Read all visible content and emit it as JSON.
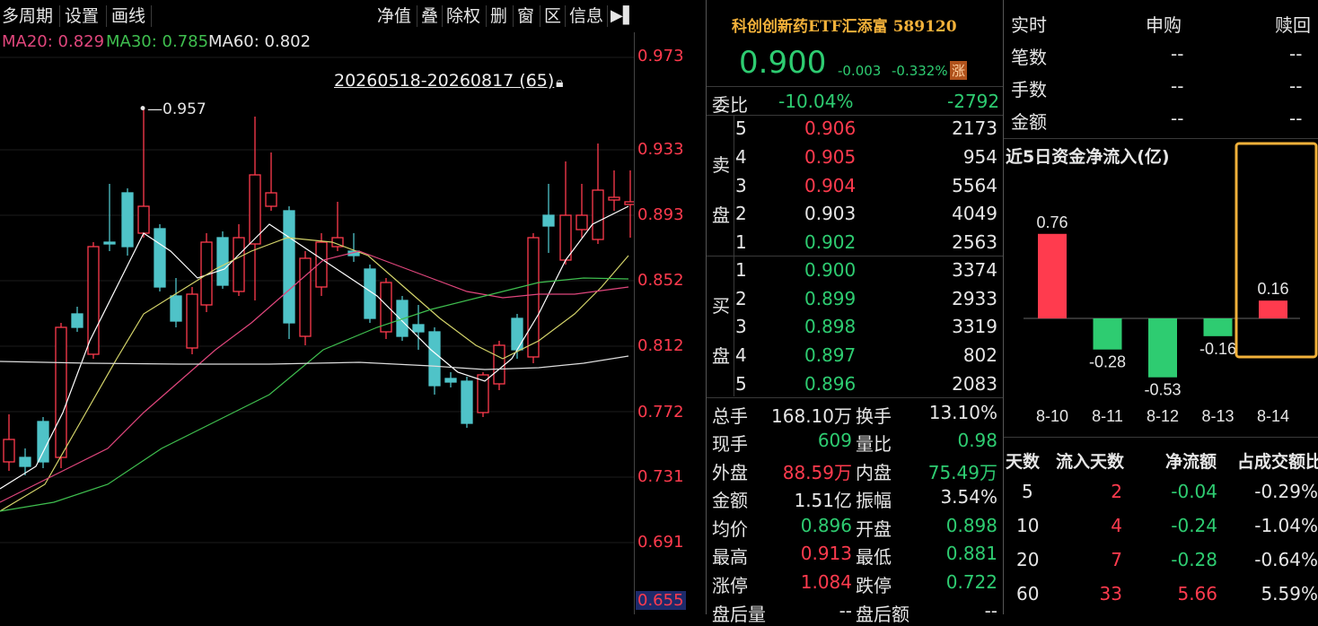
{
  "menu": {
    "period": "多周期",
    "settings": "设置",
    "draw": "画线"
  },
  "toolbar": {
    "nav": "净值",
    "overlay": "叠",
    "adjust": "除权",
    "delete": "删",
    "window": "窗",
    "zone": "区",
    "info": "信息"
  },
  "ma": {
    "ma20": "MA20: 0.829",
    "ma30": "MA30: 0.785",
    "ma60": "MA60: 0.802"
  },
  "range_label": "20260518-20260817 (65)",
  "max_label": "0.957",
  "price_ticks": [
    "0.973",
    "0.933",
    "0.893",
    "0.852",
    "0.812",
    "0.772",
    "0.731",
    "0.691",
    "0.655"
  ],
  "colors": {
    "up": "#ff3b4e",
    "down": "#2ecc71",
    "candle_down": "#4fc3c8",
    "accent": "#f2b13a"
  },
  "header": {
    "name": "科创创新药ETF汇添富 589120",
    "price": "0.900",
    "change": "-0.003",
    "change_pct": "-0.332%",
    "badge": "涨"
  },
  "ratio": {
    "label": "委比",
    "pct": "-10.04%",
    "diff": "-2792"
  },
  "sell_label_1": "卖",
  "sell_label_2": "盘",
  "buy_label_1": "买",
  "buy_label_2": "盘",
  "asks": [
    {
      "level": "5",
      "price": "0.906",
      "vol": "2173"
    },
    {
      "level": "4",
      "price": "0.905",
      "vol": "954"
    },
    {
      "level": "3",
      "price": "0.904",
      "vol": "5564"
    },
    {
      "level": "2",
      "price": "0.903",
      "vol": "4049"
    },
    {
      "level": "1",
      "price": "0.902",
      "vol": "2563"
    }
  ],
  "bids": [
    {
      "level": "1",
      "price": "0.900",
      "vol": "3374"
    },
    {
      "level": "2",
      "price": "0.899",
      "vol": "2933"
    },
    {
      "level": "3",
      "price": "0.898",
      "vol": "3319"
    },
    {
      "level": "4",
      "price": "0.897",
      "vol": "802"
    },
    {
      "level": "5",
      "price": "0.896",
      "vol": "2083"
    }
  ],
  "stats": [
    {
      "l1": "总手",
      "v1": "168.10万",
      "l2": "换手",
      "v2": "13.10%"
    },
    {
      "l1": "现手",
      "v1": "609",
      "l2": "量比",
      "v2": "0.98"
    },
    {
      "l1": "外盘",
      "v1": "88.59万",
      "l2": "内盘",
      "v2": "75.49万"
    },
    {
      "l1": "金额",
      "v1": "1.51亿",
      "l2": "振幅",
      "v2": "3.54%"
    },
    {
      "l1": "均价",
      "v1": "0.896",
      "l2": "开盘",
      "v2": "0.898"
    },
    {
      "l1": "最高",
      "v1": "0.913",
      "l2": "最低",
      "v2": "0.881"
    },
    {
      "l1": "涨停",
      "v1": "1.084",
      "l2": "跌停",
      "v2": "0.722"
    },
    {
      "l1": "盘后量",
      "v1": "--",
      "l2": "盘后额",
      "v2": "--"
    }
  ],
  "realtime": {
    "headers": [
      "实时",
      "申购",
      "赎回"
    ],
    "rows": [
      {
        "label": "笔数",
        "a": "--",
        "b": "--"
      },
      {
        "label": "手数",
        "a": "--",
        "b": "--"
      },
      {
        "label": "金额",
        "a": "--",
        "b": "--"
      }
    ]
  },
  "flow_title": "近5日资金净流入(亿)",
  "chart_data": {
    "type": "bar",
    "categories": [
      "8-10",
      "8-11",
      "8-12",
      "8-13",
      "8-14"
    ],
    "values": [
      0.76,
      -0.28,
      -0.53,
      -0.16,
      0.16
    ],
    "title": "近5日资金净流入(亿)"
  },
  "flow_table": {
    "headers": [
      "天数",
      "流入天数",
      "净流额",
      "占成交额比"
    ],
    "rows": [
      {
        "days": "5",
        "in_days": "2",
        "net": "-0.04",
        "pct": "-0.29%"
      },
      {
        "days": "10",
        "in_days": "4",
        "net": "-0.24",
        "pct": "-1.04%"
      },
      {
        "days": "20",
        "in_days": "7",
        "net": "-0.28",
        "pct": "-0.64%"
      },
      {
        "days": "60",
        "in_days": "33",
        "net": "5.66",
        "pct": "5.59%"
      }
    ]
  }
}
